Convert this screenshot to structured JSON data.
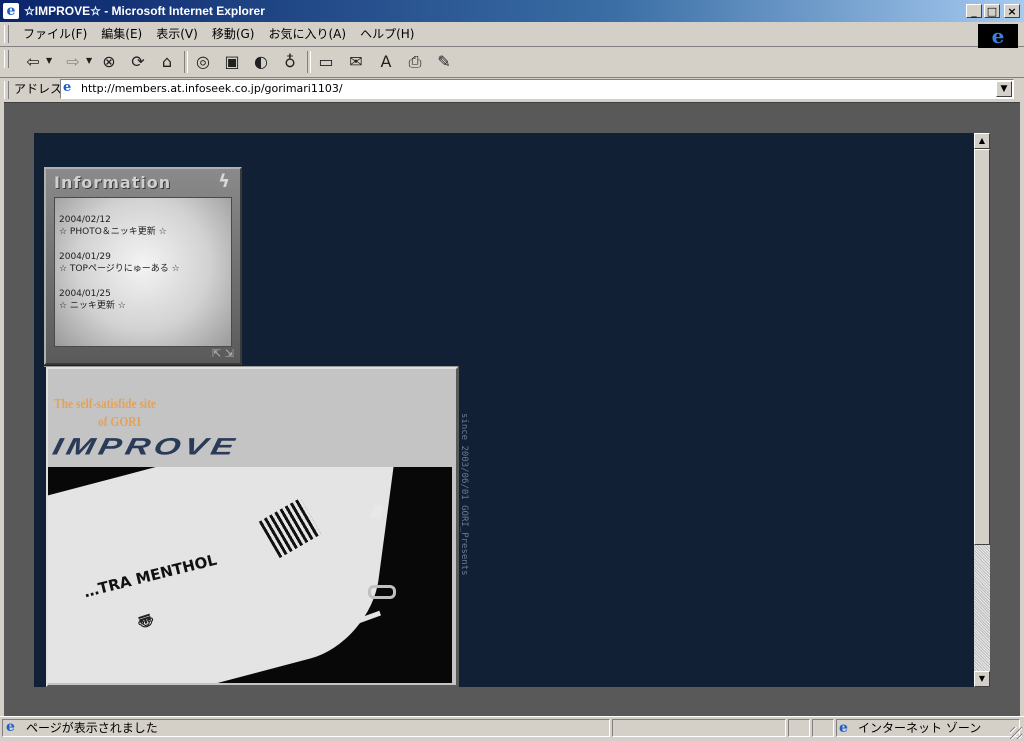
{
  "window": {
    "title": "☆IMPROVE☆ - Microsoft Internet Explorer",
    "buttons": {
      "minimize": "_",
      "maximize": "□",
      "close": "×"
    }
  },
  "menu": {
    "items": [
      "ファイル(F)",
      "編集(E)",
      "表示(V)",
      "移動(G)",
      "お気に入り(A)",
      "ヘルプ(H)"
    ]
  },
  "toolbar": {
    "icons": [
      "back-icon",
      "forward-icon",
      "stop-icon",
      "refresh-icon",
      "home-icon",
      "search-icon",
      "favorites-icon",
      "history-icon",
      "channels-icon",
      "fullscreen-icon",
      "mail-icon",
      "font-icon",
      "print-icon",
      "edit-icon"
    ]
  },
  "address": {
    "label": "アドレス",
    "url": "http://members.at.infoseek.co.jp/gorimari1103/"
  },
  "information": {
    "title": "Information",
    "news": [
      {
        "date": "2004/02/12",
        "text": "☆ PHOTO＆ニッキ更新 ☆"
      },
      {
        "date": "2004/01/29",
        "text": "☆ TOPページりにゅーある ☆"
      },
      {
        "date": "2004/01/25",
        "text": "☆ ニッキ更新 ☆"
      }
    ]
  },
  "banner": {
    "tagline_line1": "The self-satisfide site",
    "tagline_line2": "of GORI",
    "logo": "IMPROVE",
    "photo_text": "…TRA MENTHOL",
    "side_text": "since 2003/06/01 GORI_Presents"
  },
  "status": {
    "text": "ページが表示されました",
    "zone": "インターネット ゾーン"
  }
}
